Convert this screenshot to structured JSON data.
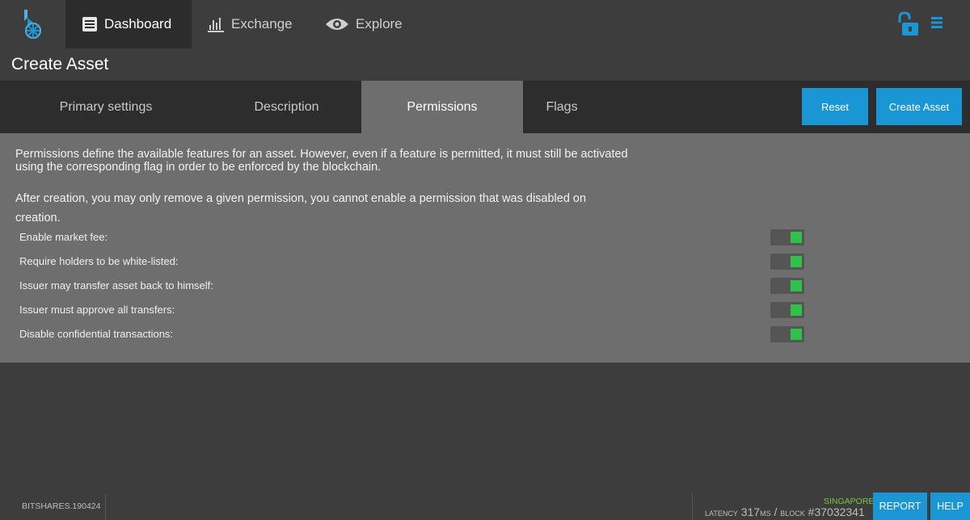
{
  "header": {
    "nav": [
      {
        "label": "Dashboard",
        "icon": "dashboard-icon",
        "active": true
      },
      {
        "label": "Exchange",
        "icon": "exchange-icon",
        "active": false
      },
      {
        "label": "Explore",
        "icon": "eye-icon",
        "active": false
      }
    ],
    "right_icons": [
      "unlock-icon",
      "menu-icon"
    ],
    "accent_color": "#1a96d4"
  },
  "page": {
    "title": "Create Asset"
  },
  "tabs": [
    {
      "label": "Primary settings",
      "active": false
    },
    {
      "label": "Description",
      "active": false
    },
    {
      "label": "Permissions",
      "active": true
    },
    {
      "label": "Flags",
      "active": false
    }
  ],
  "actions": {
    "reset_label": "Reset",
    "create_label": "Create Asset"
  },
  "permissions": {
    "intro": "Permissions define the available features for an asset. However, even if a feature is permitted, it must still be activated using the corresponding flag in order to be enforced by the blockchain.",
    "note": "After creation, you may only remove a given permission, you cannot enable a permission that was disabled on creation.",
    "items": [
      {
        "label": "Enable market fee:",
        "enabled": true
      },
      {
        "label": "Require holders to be white-listed:",
        "enabled": true
      },
      {
        "label": "Issuer may transfer asset back to himself:",
        "enabled": true
      },
      {
        "label": "Issuer must approve all transfers:",
        "enabled": true
      },
      {
        "label": "Disable confidential transactions:",
        "enabled": true
      }
    ],
    "toggle_on_color": "#2ec24a"
  },
  "footer": {
    "version": "BITSHARES.190424",
    "node": "SINGAPORE",
    "latency_label": "LATENCY",
    "latency_value": "317",
    "latency_unit": "MS",
    "separator": "/",
    "block_label": "BLOCK",
    "block_value": "#37032341",
    "report_label": "REPORT",
    "help_label": "HELP"
  }
}
